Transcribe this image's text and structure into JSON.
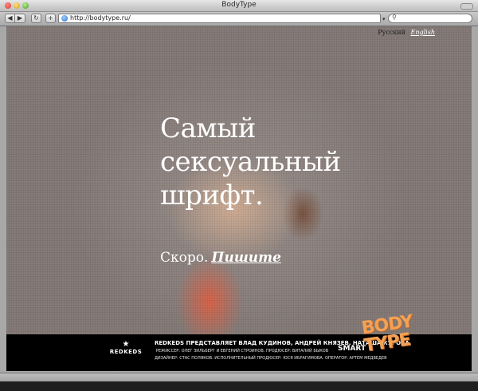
{
  "window": {
    "title": "BodyType"
  },
  "toolbar": {
    "back_icon": "chevron-left-icon",
    "forward_icon": "chevron-right-icon",
    "reload_icon": "reload-icon",
    "add_icon": "plus-icon",
    "url": "http://bodytype.ru/",
    "search_placeholder": ""
  },
  "page": {
    "lang": {
      "ru": "Русский",
      "en": "English"
    },
    "headline": [
      "Самый",
      "сексуальный",
      "шрифт."
    ],
    "soon": "Скоро.",
    "write_link": "Пишите",
    "logo_lines": [
      "BODY",
      "TYPE"
    ],
    "footer": {
      "left_brand": "REDKEDS",
      "line1": "REDKEDS ПРЕДСТАВЛЯЕТ ВЛАД КУДИНОВ, АНДРЕЙ КНЯЗЕВ, НАТАША КУРОВА",
      "line2": "РЕЖИССЕР: ОЛЕГ ЗИЛЬБЕРГ И ЕВГЕНИЙ СТРОИНОВ. ПРОДЮСЕР: ВИТАЛИЙ БЫКОВ",
      "line3": "ДИЗАЙНЕР: СТАС ПОЛЯКОВ. ИСПОЛНИТЕЛЬНЫЙ ПРОДЮСЕР: ЮСЯ ИБРАГИМОВА. ОПЕРАТОР: АРТЕМ МЕДВЕДЕВ",
      "right_brand": "SMART"
    }
  },
  "colors": {
    "page_bg": "#887e7b",
    "text": "#ffffff",
    "logo": "#f3a154",
    "footer": "#000000"
  }
}
